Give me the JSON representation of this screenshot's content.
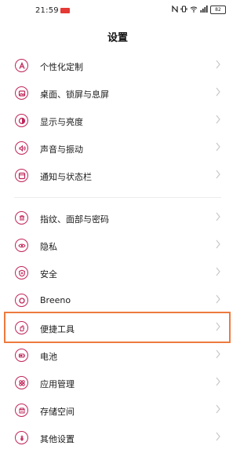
{
  "status_bar": {
    "time": "21:59",
    "battery": "82",
    "icons": [
      "nfc-icon",
      "vibrate-icon",
      "wifi-icon",
      "signal-icon",
      "battery-icon"
    ]
  },
  "header": {
    "title": "设置"
  },
  "groups": [
    {
      "items": [
        {
          "label": "个性化定制",
          "icon": "personalization-icon"
        },
        {
          "label": "桌面、锁屏与息屏",
          "icon": "wallpaper-icon"
        },
        {
          "label": "显示与亮度",
          "icon": "display-brightness-icon"
        },
        {
          "label": "声音与振动",
          "icon": "sound-vibration-icon"
        },
        {
          "label": "通知与状态栏",
          "icon": "notification-icon"
        }
      ]
    },
    {
      "items": [
        {
          "label": "指纹、面部与密码",
          "icon": "fingerprint-icon"
        },
        {
          "label": "隐私",
          "icon": "privacy-eye-icon"
        },
        {
          "label": "安全",
          "icon": "security-shield-icon"
        },
        {
          "label": "Breeno",
          "icon": "breeno-icon"
        },
        {
          "label": "便捷工具",
          "icon": "convenience-tools-icon",
          "highlighted": true
        },
        {
          "label": "电池",
          "icon": "battery-icon"
        },
        {
          "label": "应用管理",
          "icon": "app-management-icon"
        },
        {
          "label": "存储空间",
          "icon": "storage-icon"
        },
        {
          "label": "其他设置",
          "icon": "other-settings-icon"
        }
      ]
    }
  ],
  "colors": {
    "accent": "#c0245a",
    "highlight_border": "#ee7a3e",
    "divider": "#ececec"
  }
}
